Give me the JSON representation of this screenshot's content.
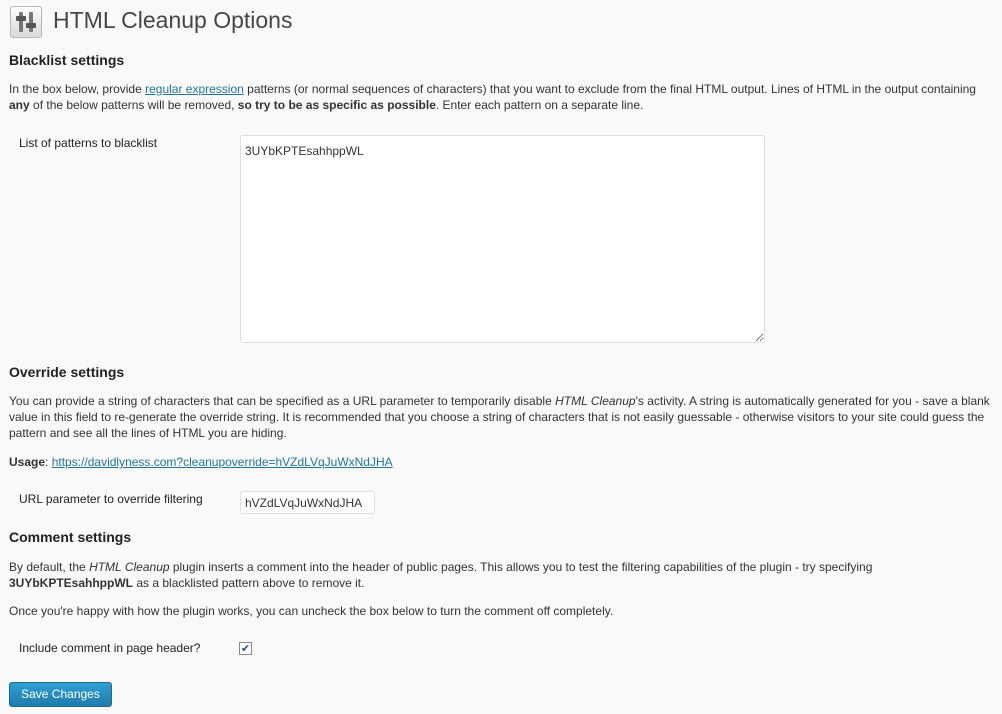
{
  "page": {
    "title": "HTML Cleanup Options",
    "icon": "settings-sliders-icon"
  },
  "blacklist": {
    "heading": "Blacklist settings",
    "desc_pre": "In the box below, provide ",
    "desc_link": "regular expression",
    "desc_mid1": " patterns (or normal sequences of characters) that you want to exclude from the final HTML output. Lines of HTML in the output containing ",
    "desc_bold1": "any",
    "desc_mid2": " of the below patterns will be removed, ",
    "desc_bold2": "so try to be as specific as possible",
    "desc_post": ". Enter each pattern on a separate line.",
    "field_label": "List of patterns to blacklist",
    "field_value": "3UYbKPTEsahhppWL"
  },
  "override": {
    "heading": "Override settings",
    "desc_pre": "You can provide a string of characters that can be specified as a URL parameter to temporarily disable ",
    "desc_italic": "HTML Cleanup",
    "desc_post": "'s activity. A string is automatically generated for you - save a blank value in this field to re-generate the override string. It is recommended that you choose a string of characters that is not easily guessable - otherwise visitors to your site could guess the pattern and see all the lines of HTML you are hiding.",
    "usage_label": "Usage",
    "usage_sep": ": ",
    "usage_url": "https://davidlyness.com?cleanupoverride=hVZdLVqJuWxNdJHA",
    "field_label": "URL parameter to override filtering",
    "field_value": "hVZdLVqJuWxNdJHA"
  },
  "comment": {
    "heading": "Comment settings",
    "desc_pre": "By default, the ",
    "desc_italic": "HTML Cleanup",
    "desc_mid": " plugin inserts a comment into the header of public pages. This allows you to test the filtering capabilities of the plugin - try specifying ",
    "desc_bold": "3UYbKPTEsahhppWL",
    "desc_post": " as a blacklisted pattern above to remove it.",
    "desc2": "Once you're happy with how the plugin works, you can uncheck the box below to turn the comment off completely.",
    "field_label": "Include comment in page header?",
    "checked": true,
    "check_glyph": "✔"
  },
  "actions": {
    "save_label": "Save Changes"
  },
  "colors": {
    "link": "#21759b",
    "button": "#2188bd",
    "background": "#f9f9f9"
  }
}
